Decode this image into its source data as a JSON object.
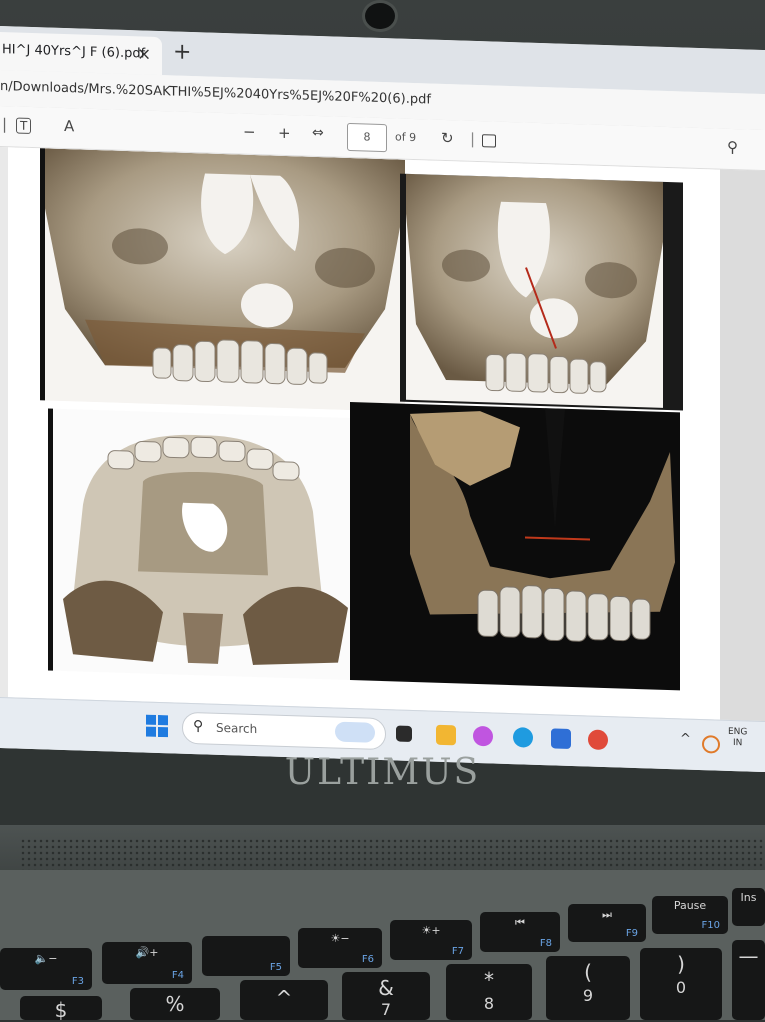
{
  "browser": {
    "tab_title": "HI^J 40Yrs^J F (6).pdf",
    "tab_close": "×",
    "new_tab": "+",
    "url": "n/Downloads/Mrs.%20SAKTHI%5EJ%2040Yrs%5EJ%20F%20(6).pdf"
  },
  "pdf_toolbar": {
    "text_tool": "T",
    "read_aloud": "A",
    "zoom_out": "−",
    "zoom_in": "+",
    "fit": "⇔",
    "page_number": "8",
    "page_count": "of 9",
    "rotate": "↻",
    "search": "⚲"
  },
  "taskbar": {
    "search_placeholder": "Search",
    "search_glyph": "⚲",
    "tray_chevron": "^",
    "lang_line1": "ENG",
    "lang_line2": "IN",
    "pinned": [
      {
        "name": "file-explorer-icon",
        "color": "#f2b632"
      },
      {
        "name": "copilot-icon",
        "color": "#c055e0"
      },
      {
        "name": "edge-icon",
        "color": "#1f9be0"
      },
      {
        "name": "store-icon",
        "color": "#2f6fd6"
      },
      {
        "name": "chrome-icon",
        "color": "#e04a3a"
      }
    ]
  },
  "laptop": {
    "brand": "ULTIMUS"
  },
  "keyboard": {
    "function_row": [
      {
        "label": "🔈−",
        "fn": "F3"
      },
      {
        "label": "🔊+",
        "fn": "F4"
      },
      {
        "label": "",
        "fn": "F5"
      },
      {
        "label": "☀−",
        "fn": "F6"
      },
      {
        "label": "☀+",
        "fn": "F7"
      },
      {
        "label": "⏮",
        "fn": "F8"
      },
      {
        "label": "⏭",
        "fn": "F9"
      },
      {
        "label": "Pause",
        "fn": "F10"
      },
      {
        "label": "Ins",
        "fn": ""
      }
    ],
    "number_row": [
      "$",
      "%",
      "^",
      "&",
      "*",
      "(",
      ")"
    ],
    "number_row_sub": [
      "",
      "",
      "",
      "7",
      "8",
      "9",
      "0"
    ]
  }
}
